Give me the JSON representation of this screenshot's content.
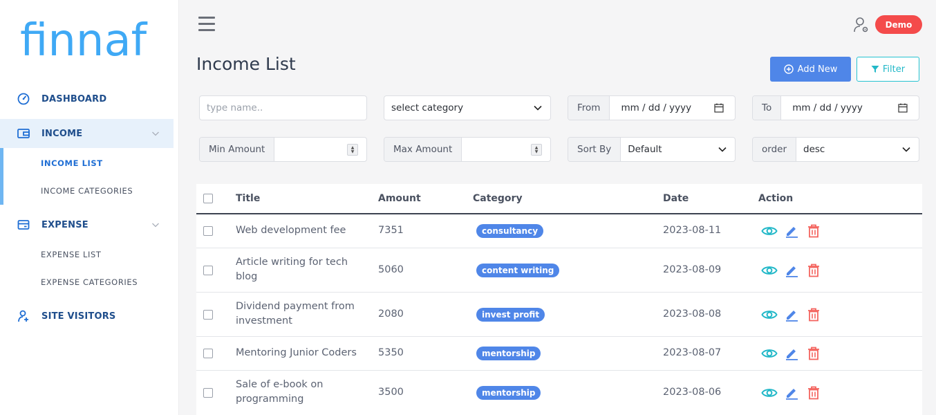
{
  "brand": {
    "logo": "finnaf"
  },
  "sidebar": {
    "items": [
      {
        "label": "DASHBOARD",
        "icon": "dashboard-icon"
      },
      {
        "label": "INCOME",
        "icon": "wallet-icon",
        "active": true
      },
      {
        "label": "EXPENSE",
        "icon": "card-icon"
      },
      {
        "label": "SITE VISITORS",
        "icon": "user-add-icon"
      }
    ],
    "income_sub": [
      {
        "label": "INCOME LIST",
        "active": true
      },
      {
        "label": "INCOME CATEGORIES"
      }
    ],
    "expense_sub": [
      {
        "label": "EXPENSE LIST"
      },
      {
        "label": "EXPENSE CATEGORIES"
      }
    ]
  },
  "header": {
    "user_badge": "Demo"
  },
  "page": {
    "title": "Income List",
    "add_label": "Add New",
    "filter_label": "Filter"
  },
  "filters": {
    "name_placeholder": "type name..",
    "category_value": "select category",
    "from_label": "From",
    "from_value": "mm / dd / yyyy",
    "to_label": "To",
    "to_value": "mm / dd / yyyy",
    "min_amount_label": "Min Amount",
    "max_amount_label": "Max Amount",
    "sort_label": "Sort By",
    "sort_value": "Default",
    "order_label": "order",
    "order_value": "desc"
  },
  "table": {
    "headers": {
      "title": "Title",
      "amount": "Amount",
      "category": "Category",
      "date": "Date",
      "action": "Action"
    },
    "rows": [
      {
        "title": "Web development fee",
        "amount": "7351",
        "category": "consultancy",
        "date": "2023-08-11"
      },
      {
        "title": "Article writing for tech blog",
        "amount": "5060",
        "category": "content writing",
        "date": "2023-08-09"
      },
      {
        "title": "Dividend payment from investment",
        "amount": "2080",
        "category": "invest profit",
        "date": "2023-08-08"
      },
      {
        "title": "Mentoring Junior Coders",
        "amount": "5350",
        "category": "mentorship",
        "date": "2023-08-07"
      },
      {
        "title": "Sale of e-book on programming",
        "amount": "3500",
        "category": "mentorship",
        "date": "2023-08-06"
      }
    ]
  },
  "colors": {
    "brand": "#3fa9f5",
    "primary": "#4f86e8",
    "info": "#22b8c8",
    "danger": "#f44b4b"
  }
}
